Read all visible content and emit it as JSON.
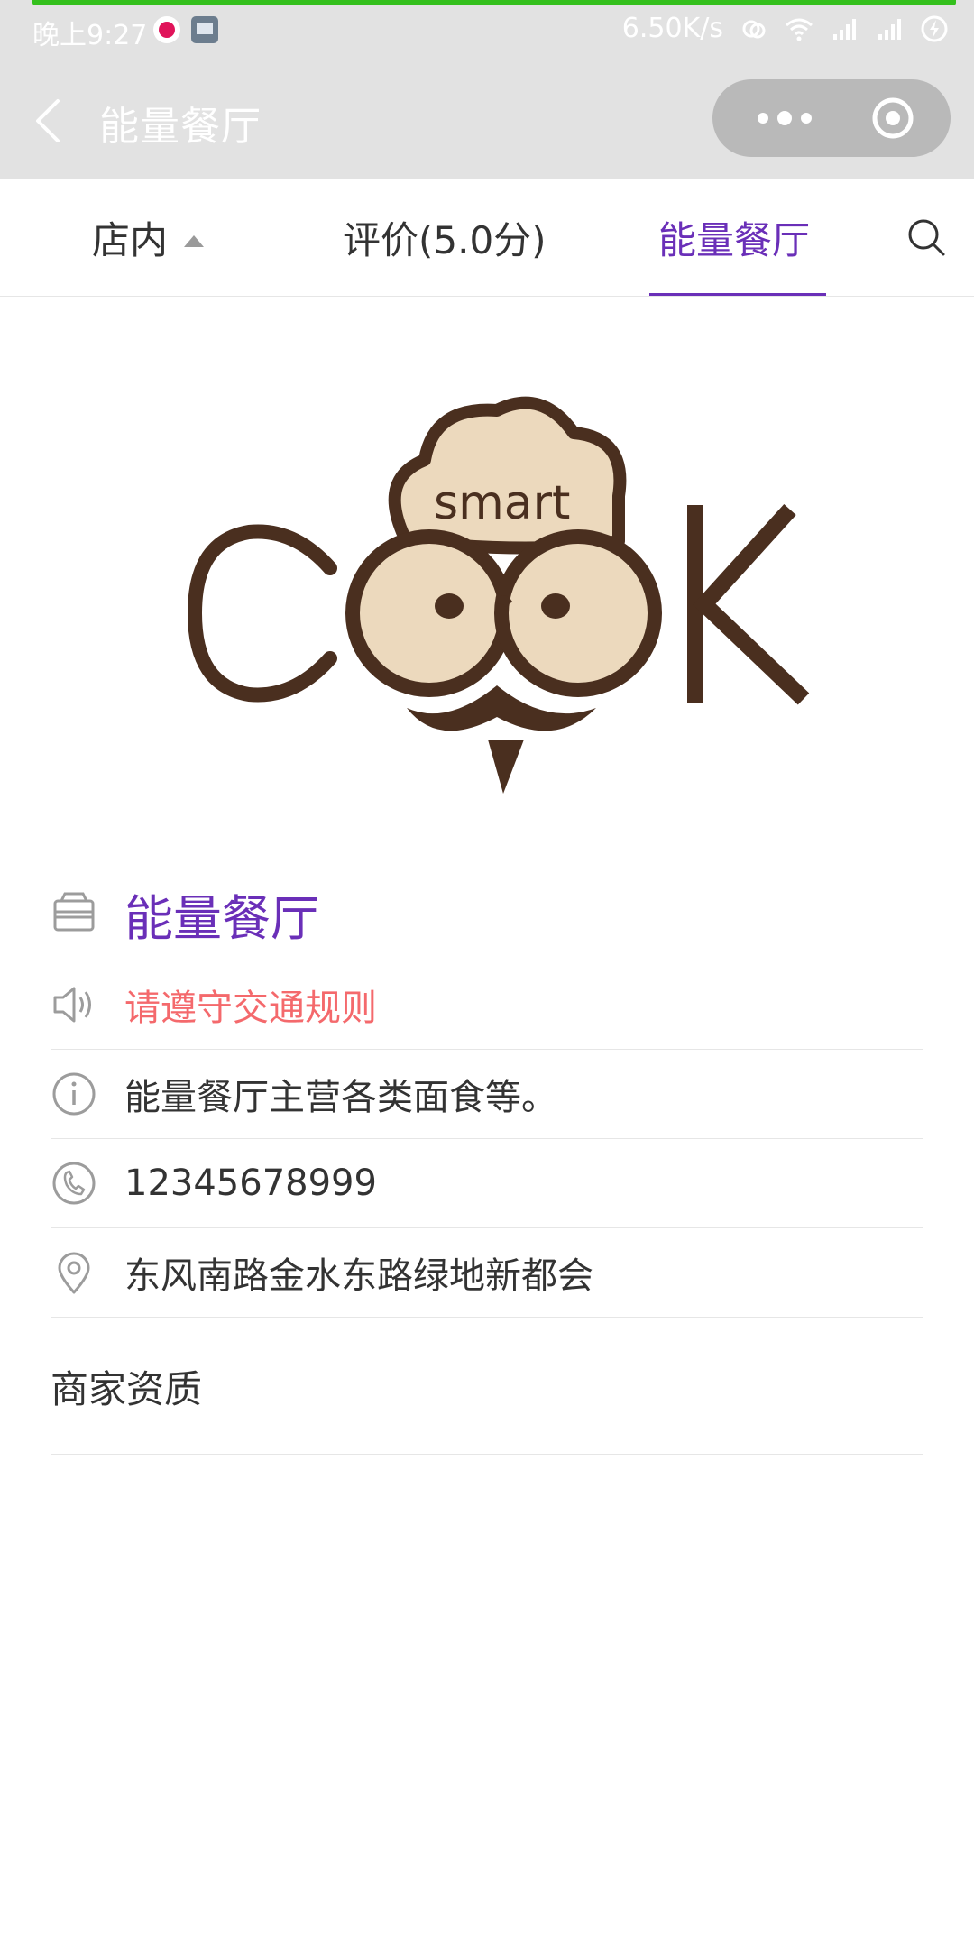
{
  "status_bar": {
    "time": "晚上9:27",
    "network_speed": "6.50K/s"
  },
  "nav": {
    "title": "能量餐厅",
    "back_icon": "chevron-left-icon",
    "more_icon": "more-dots-icon",
    "close_icon": "target-close-icon"
  },
  "tabs": {
    "items": [
      {
        "label": "店内",
        "icon": "caret-up-icon"
      },
      {
        "label": "评价(5.0分)"
      },
      {
        "label": "能量餐厅",
        "active": true
      }
    ],
    "search_icon": "search-icon",
    "active_color": "#6a2fb8"
  },
  "logo": {
    "text": "smart COOK"
  },
  "info": {
    "name": "能量餐厅",
    "notice": "请遵守交通规则",
    "description": "能量餐厅主营各类面食等。",
    "phone": "12345678999",
    "address": "东风南路金水东路绿地新都会",
    "icons": [
      "store-icon",
      "speaker-icon",
      "info-icon",
      "phone-icon",
      "location-pin-icon"
    ],
    "notice_color": "#f4696c"
  },
  "qualification": {
    "label": "商家资质"
  }
}
